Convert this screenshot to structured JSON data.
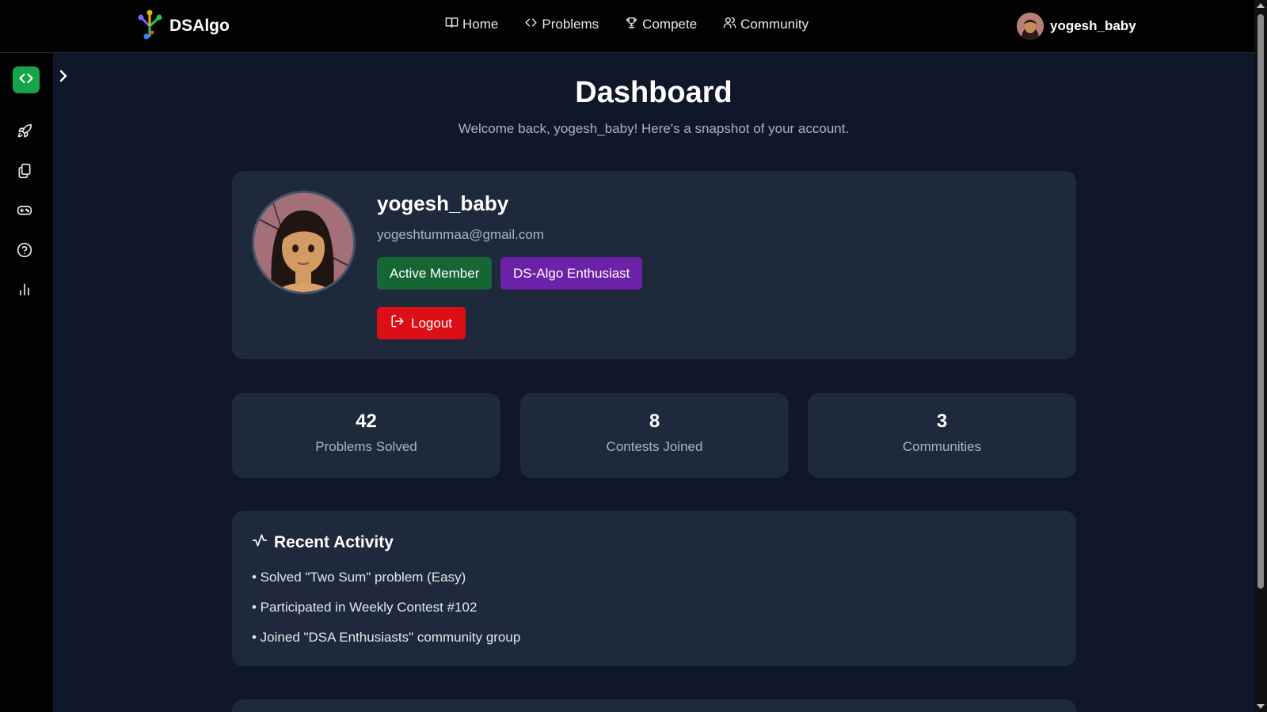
{
  "navbar": {
    "brand": "DSAlgo",
    "links": [
      {
        "label": "Home",
        "icon": "book-open-icon"
      },
      {
        "label": "Problems",
        "icon": "code-icon"
      },
      {
        "label": "Compete",
        "icon": "trophy-icon"
      },
      {
        "label": "Community",
        "icon": "users-icon"
      }
    ],
    "username": "yogesh_baby"
  },
  "sidebar": {
    "logo_icon": "code-brackets-icon",
    "toggle_icon": "chevron-right-icon",
    "items": [
      {
        "icon": "rocket-icon"
      },
      {
        "icon": "files-icon"
      },
      {
        "icon": "gamepad-icon"
      },
      {
        "icon": "help-circle-icon"
      },
      {
        "icon": "bar-chart-icon"
      }
    ]
  },
  "header": {
    "title": "Dashboard",
    "subtitle": "Welcome back, yogesh_baby! Here's a snapshot of your account."
  },
  "profile": {
    "name": "yogesh_baby",
    "email": "yogeshtummaa@gmail.com",
    "badges": [
      "Active Member",
      "DS-Algo Enthusiast"
    ],
    "logout_label": "Logout"
  },
  "stats": [
    {
      "value": "42",
      "label": "Problems Solved"
    },
    {
      "value": "8",
      "label": "Contests Joined"
    },
    {
      "value": "3",
      "label": "Communities"
    }
  ],
  "activity": {
    "title": "Recent Activity",
    "items": [
      "• Solved \"Two Sum\" problem (Easy)",
      "• Participated in Weekly Contest #102",
      "• Joined \"DSA Enthusiasts\" community group"
    ]
  },
  "colors": {
    "background": "#0f172a",
    "card": "#1e293b",
    "navbar": "#020202",
    "green_badge": "#166534",
    "purple_badge": "#6b21a8",
    "logout": "#dc0f17",
    "logo_green": "#16a34a"
  }
}
